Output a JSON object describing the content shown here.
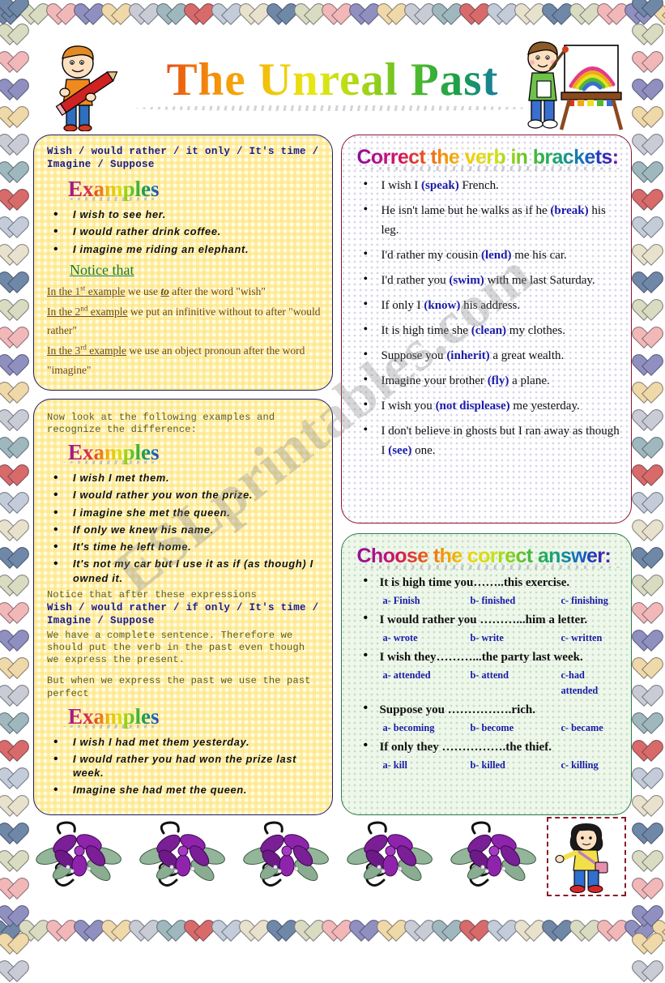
{
  "page": {
    "title": "The Unreal Past",
    "watermark": "ESLprintables.com"
  },
  "clipart": {
    "left_header": "boy-with-pencil-icon",
    "right_header": "boy-painting-rainbow-icon",
    "footer_flower": "purple-flower-icon",
    "footer_girl": "girl-with-bag-icon"
  },
  "left_column": {
    "card1": {
      "expressions": "Wish / would rather / it only / It's time / Imagine / Suppose",
      "examples_label": "Examples",
      "examples": [
        "I wish to see her.",
        "I would rather drink coffee.",
        "I imagine me riding an elephant."
      ],
      "notice_label": "Notice that",
      "notes": [
        {
          "underlined": "In the 1st example",
          "rest_before": " we use ",
          "emphasis": "to",
          "rest_after": " after the word \"wish\""
        },
        {
          "underlined": "In the 2nd example",
          "rest_before": " we put an infinitive without to after \"would rather\"",
          "emphasis": "",
          "rest_after": ""
        },
        {
          "underlined": "In the 3rd example",
          "rest_before": " we use an object pronoun after the word \"imagine\"",
          "emphasis": "",
          "rest_after": ""
        }
      ]
    },
    "card2": {
      "intro": "Now look at the following examples and recognize the difference:",
      "examples_label": "Examples",
      "examples": [
        "I wish I met them.",
        "I would rather you won the prize.",
        "I imagine she met the queen.",
        "If only we knew his name.",
        "It's time he left home.",
        "It's not my car but I use it as if (as though) I owned it."
      ],
      "notice_intro": "Notice that after these expressions",
      "expressions": "Wish / would rather / if only / It's time / Imagine / Suppose",
      "rule": "We have a complete sentence. Therefore we should put the verb in the past even though we express the present.",
      "rule2": "But when we express the past we use the past perfect",
      "examples2_label": "Examples",
      "examples2": [
        "I wish I had met them yesterday.",
        "I would rather you had won the prize last week.",
        "Imagine she had met the queen."
      ]
    }
  },
  "right_column": {
    "exercise1": {
      "heading": "Correct the verb in brackets:",
      "items": [
        {
          "before": "I wish I ",
          "verb": "(speak)",
          "after": " French."
        },
        {
          "before": "He isn't lame but he walks as if he ",
          "verb": "(break)",
          "after": " his leg."
        },
        {
          "before": "I'd rather my cousin ",
          "verb": "(lend)",
          "after": " me his car."
        },
        {
          "before": "I'd rather you ",
          "verb": "(swim)",
          "after": " with me last Saturday."
        },
        {
          "before": "If only I ",
          "verb": "(know)",
          "after": " his address."
        },
        {
          "before": "It is high time she ",
          "verb": "(clean)",
          "after": " my clothes."
        },
        {
          "before": "Suppose you ",
          "verb": "(inherit)",
          "after": " a great wealth."
        },
        {
          "before": "Imagine your brother ",
          "verb": "(fly)",
          "after": " a plane."
        },
        {
          "before": "I wish you ",
          "verb": "(not displease)",
          "after": " me yesterday."
        },
        {
          "before": "I don't believe in ghosts but I ran away as though I ",
          "verb": "(see)",
          "after": " one."
        }
      ]
    },
    "exercise2": {
      "heading": "Choose the correct answer:",
      "items": [
        {
          "stem": "It is high time you……..this exercise.",
          "options": [
            "a- Finish",
            "b- finished",
            "c- finishing"
          ]
        },
        {
          "stem": "I would rather you ………...him a letter.",
          "options": [
            "a- wrote",
            "b- write",
            "c- written"
          ]
        },
        {
          "stem": "I wish they………...the party last week.",
          "options": [
            "a- attended",
            "b- attend",
            "c-had attended"
          ]
        },
        {
          "stem": "Suppose you …………….rich.",
          "options": [
            "a- becoming",
            "b- become",
            "c- became"
          ]
        },
        {
          "stem": "If only they …………….the thief.",
          "options": [
            "a- kill",
            "b- killed",
            "c- killing"
          ]
        }
      ]
    }
  },
  "colors": {
    "title_start": "#a3199b",
    "navy_border": "#1b1b6e",
    "maroon_border": "#8e1430",
    "green_border": "#2f7a4e",
    "verb_blue": "#1a1aa8",
    "notice_green": "#1d7a2e"
  }
}
